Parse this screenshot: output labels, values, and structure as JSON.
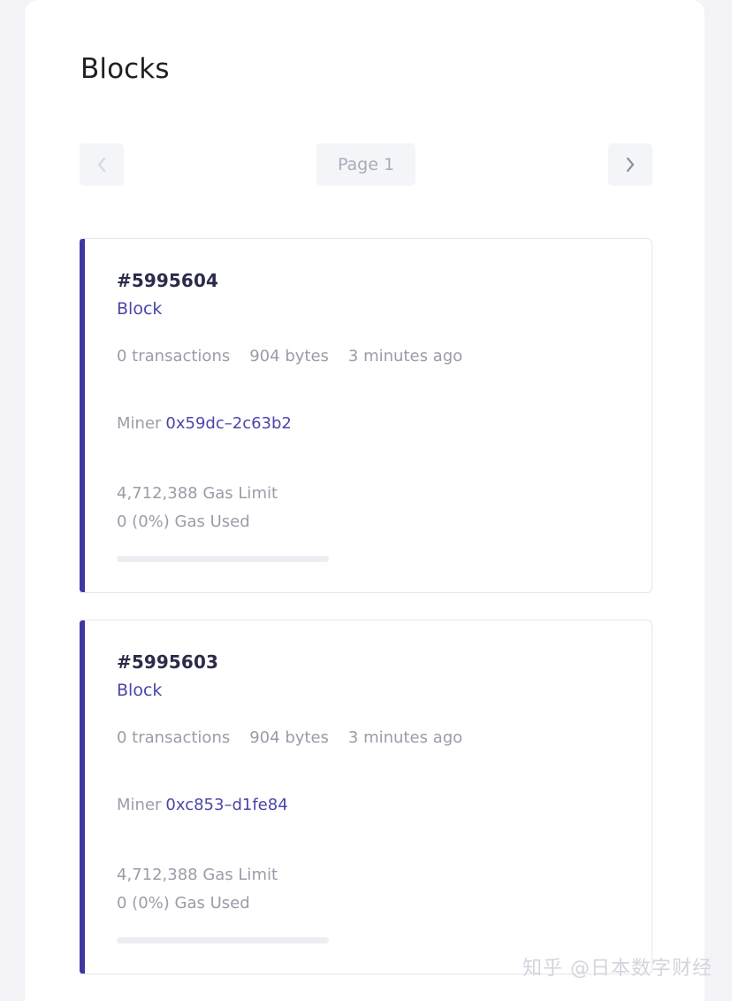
{
  "page": {
    "title": "Blocks",
    "background_color": "#f3f3f8",
    "panel_color": "#ffffff",
    "accent_color": "#3f37a3",
    "link_color": "#4a45a8",
    "muted_text_color": "#9a9ca8"
  },
  "pagination": {
    "prev_label": "‹",
    "prev_icon": "chevron-left-icon",
    "prev_disabled": true,
    "page_label": "Page 1",
    "page_number": 1,
    "next_label": "›",
    "next_icon": "chevron-right-icon",
    "next_disabled": false
  },
  "blocks": [
    {
      "number": "#5995604",
      "type_label": "Block",
      "transactions": "0 transactions",
      "size": "904 bytes",
      "age": "3 minutes ago",
      "miner_label": "Miner",
      "miner_address": "0x59dc–2c63b2",
      "gas_limit": "4,712,388 Gas Limit",
      "gas_used": "0 (0%) Gas Used",
      "gas_used_percent": 0
    },
    {
      "number": "#5995603",
      "type_label": "Block",
      "transactions": "0 transactions",
      "size": "904 bytes",
      "age": "3 minutes ago",
      "miner_label": "Miner",
      "miner_address": "0xc853–d1fe84",
      "gas_limit": "4,712,388 Gas Limit",
      "gas_used": "0 (0%) Gas Used",
      "gas_used_percent": 0
    }
  ],
  "watermark": {
    "text": "知乎 @日本数字财经"
  }
}
